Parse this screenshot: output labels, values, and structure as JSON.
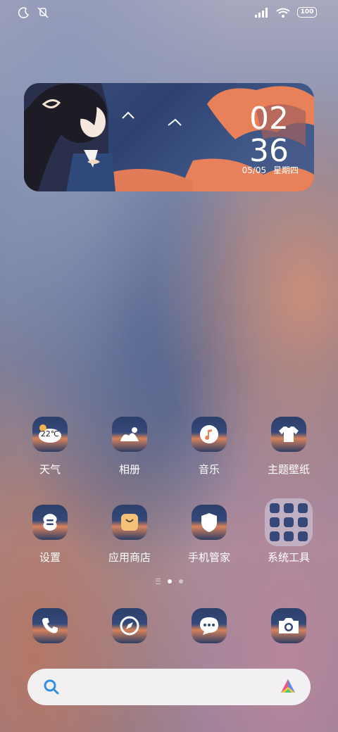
{
  "status_bar": {
    "left_icons": [
      "moon-icon",
      "mute-icon"
    ],
    "right_icons": [
      "signal-icon",
      "wifi-icon"
    ],
    "battery": "100"
  },
  "clock_widget": {
    "hour": "02",
    "minute": "36",
    "date": "05/05",
    "weekday": "星期四"
  },
  "apps": [
    {
      "label": "天气",
      "icon": "weather-icon",
      "badge": "22℃"
    },
    {
      "label": "相册",
      "icon": "gallery-icon"
    },
    {
      "label": "音乐",
      "icon": "music-icon"
    },
    {
      "label": "主题壁纸",
      "icon": "theme-icon"
    },
    {
      "label": "设置",
      "icon": "settings-icon"
    },
    {
      "label": "应用商店",
      "icon": "app-store-icon"
    },
    {
      "label": "手机管家",
      "icon": "security-icon"
    },
    {
      "label": "系统工具",
      "icon": "folder-icon"
    }
  ],
  "page_indicator": {
    "pages": 2,
    "active": 1
  },
  "dock": [
    {
      "icon": "phone-icon"
    },
    {
      "icon": "browser-icon"
    },
    {
      "icon": "messages-icon"
    },
    {
      "icon": "camera-icon"
    }
  ],
  "search": {
    "icon": "search-icon",
    "assistant_icon": "assistant-icon"
  },
  "colors": {
    "accent": "#2f8fe6",
    "icon_bg": "#34497a"
  }
}
